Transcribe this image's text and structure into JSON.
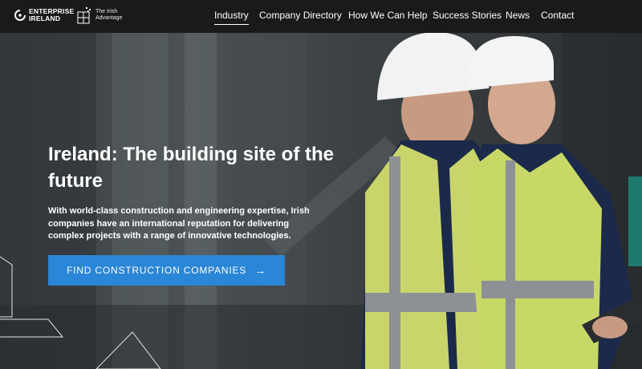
{
  "header": {
    "brand": {
      "line1": "ENTERPRISE",
      "line2": "IRELAND",
      "logo_icon": "enterprise-ireland-mark"
    },
    "sub_brand": {
      "line1": "The Irish",
      "line2": "Advantage",
      "logo_icon": "irish-advantage-mark"
    },
    "nav": [
      {
        "label": "Industry",
        "active": true
      },
      {
        "label": "Company Directory",
        "active": false
      },
      {
        "label": "How We Can Help",
        "active": false
      },
      {
        "label": "Success Stories",
        "active": false
      },
      {
        "label": "News",
        "active": false
      },
      {
        "label": "Contact",
        "active": false
      }
    ]
  },
  "hero": {
    "headline": "Ireland: The building site of the future",
    "subtext": "With world-class construction and engineering expertise, Irish companies have an international reputation for delivering complex projects with a range of innovative technologies.",
    "cta": {
      "label": "FIND CONSTRUCTION COMPANIES",
      "icon": "arrow-right-icon"
    }
  },
  "colors": {
    "topbar": "#1a1a1a",
    "cta": "#2a86d6",
    "accent_tab": "#1f7a6e"
  }
}
